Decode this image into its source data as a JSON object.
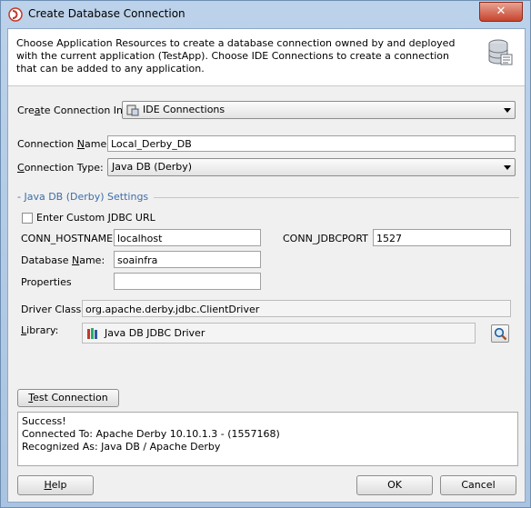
{
  "window": {
    "title": "Create Database Connection",
    "close_symbol": "✕"
  },
  "header": {
    "description": "Choose Application Resources to create a database connection owned by and deployed with the current application (TestApp). Choose IDE Connections to create a connection that can be added to any application.",
    "icon": "database-icon"
  },
  "form": {
    "create_in": {
      "label_pre": "Cre",
      "label_mnemonic": "a",
      "label_post": "te Connection In:",
      "value": "IDE Connections",
      "icon": "ide-connections-icon"
    },
    "connection_name": {
      "label_pre": "Connection ",
      "label_mnemonic": "N",
      "label_post": "ame:",
      "value": "Local_Derby_DB"
    },
    "connection_type": {
      "label_pre": "",
      "label_mnemonic": "C",
      "label_post": "onnection Type:",
      "value": "Java DB (Derby)"
    }
  },
  "settings": {
    "section_title": "- Java DB (Derby) Settings",
    "custom_jdbc": {
      "label_pre": "Enter Custom ",
      "label_mnemonic": "J",
      "label_post": "DBC URL",
      "checked": false
    },
    "hostname": {
      "label": "CONN_HOSTNAME",
      "value": "localhost"
    },
    "jdbcport": {
      "label": "CONN_JDBCPORT",
      "value": "1527"
    },
    "database_name": {
      "label_pre": "Database ",
      "label_mnemonic": "N",
      "label_post": "ame:",
      "value": "soainfra"
    },
    "properties": {
      "label": "Properties",
      "value": ""
    },
    "driver_class": {
      "label": "Driver Class:",
      "value": "org.apache.derby.jdbc.ClientDriver"
    },
    "library": {
      "label_pre": "",
      "label_mnemonic": "L",
      "label_post": "ibrary:",
      "value": "Java DB JDBC Driver",
      "icon": "library-books-icon",
      "browse_icon": "search-icon"
    }
  },
  "test": {
    "button_pre": "",
    "button_mnemonic": "T",
    "button_post": "est Connection",
    "status_lines": [
      "Success!",
      "Connected To: Apache Derby 10.10.1.3 - (1557168)",
      "Recognized As: Java DB / Apache Derby"
    ]
  },
  "footer": {
    "help_pre": "",
    "help_mnemonic": "H",
    "help_post": "elp",
    "ok": "OK",
    "cancel": "Cancel"
  }
}
